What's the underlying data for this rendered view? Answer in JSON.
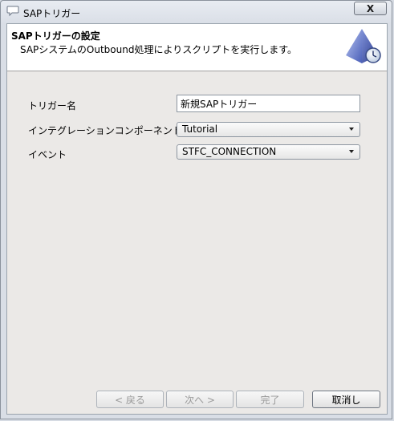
{
  "window": {
    "title": "SAPトリガー",
    "close_label": "X"
  },
  "header": {
    "title": "SAPトリガーの設定",
    "description": "SAPシステムのOutbound処理によりスクリプトを実行します。"
  },
  "form": {
    "trigger_name": {
      "label": "トリガー名",
      "value": "新規SAPトリガー"
    },
    "integration_component": {
      "label": "インテグレーションコンポーネント",
      "value": "Tutorial"
    },
    "event": {
      "label": "イベント",
      "value": "STFC_CONNECTION"
    }
  },
  "buttons": {
    "back": "< 戻る",
    "next": "次へ >",
    "finish": "完了",
    "cancel": "取消し"
  },
  "icons": {
    "title": "speech-bubble-icon",
    "header": "pyramid-clock-icon"
  },
  "colors": {
    "header_band": "#ffffff",
    "client_bg": "#ebe9e7",
    "disabled_text": "#9a9a9a"
  }
}
